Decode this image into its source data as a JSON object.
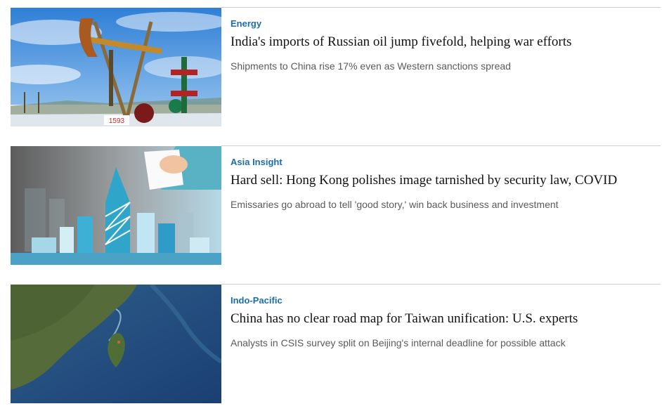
{
  "articles": [
    {
      "category": "Energy",
      "headline": "India's imports of Russian oil jump fivefold, helping war efforts",
      "summary": "Shipments to China rise 17% even as Western sanctions spread",
      "image": {
        "label": "1593"
      }
    },
    {
      "category": "Asia Insight",
      "headline": "Hard sell: Hong Kong polishes image tarnished by security law, COVID",
      "summary": "Emissaries go abroad to tell 'good story,' win back business and investment"
    },
    {
      "category": "Indo-Pacific",
      "headline": "China has no clear road map for Taiwan unification: U.S. experts",
      "summary": "Analysts in CSIS survey split on Beijing's internal deadline for possible attack"
    }
  ],
  "colors": {
    "category": "#1a6ea8",
    "headline": "#111111",
    "summary": "#5a5a5a",
    "divider": "#cfcfcf"
  }
}
